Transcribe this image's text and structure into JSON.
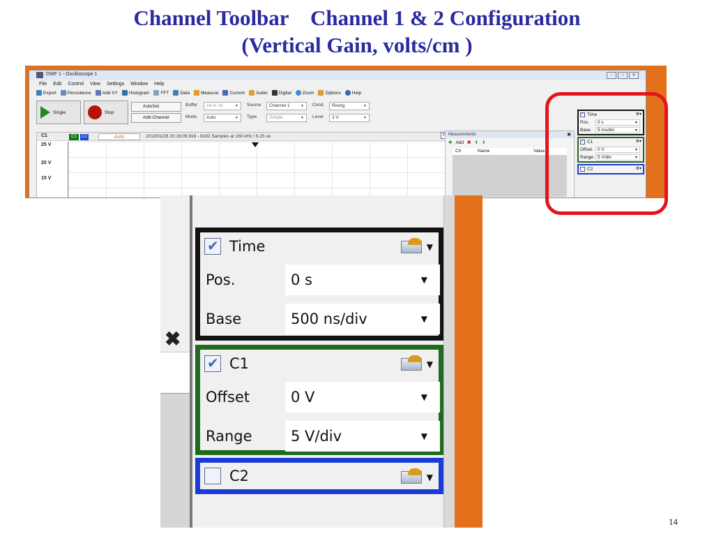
{
  "slide": {
    "title_line1": "Channel Toolbar    Channel 1 & 2 Configuration",
    "title_line2": "(Vertical Gain, volts/cm )",
    "page_number": "14"
  },
  "window": {
    "title": "DWF 1 - Oscilloscope 1",
    "menu": [
      "File",
      "Edit",
      "Control",
      "View",
      "Settings",
      "Window",
      "Help"
    ],
    "toolbar": [
      "Export",
      "Persistence",
      "Add XY",
      "Histogram",
      "FFT",
      "Data",
      "Measure",
      "Current",
      "Audio",
      "Digital",
      "Zoom",
      "Options",
      "Help"
    ]
  },
  "controls": {
    "single_label": "Single",
    "stop_label": "Stop",
    "autoset_label": "AutoSet",
    "add_channel_label": "Add Channel",
    "buffer_label": "Buffer",
    "buffer_value": "16 of 16",
    "mode_label": "Mode",
    "mode_value": "Auto",
    "source_label": "Source",
    "source_value": "Channel 1",
    "type_label": "Type",
    "type_value": "Simple",
    "cond_label": "Cond.",
    "cond_value": "Rising",
    "level_label": "Level",
    "level_value": "3 V"
  },
  "scope": {
    "channel_name": "C1",
    "chip_c1": "C1",
    "chip_c2": "C2",
    "trigger_state": "Auto",
    "status": "2013/01/28 20:16:09.916 - 8192 Samples at 160 kHz / 6.25 us",
    "y_labels": [
      "25 V",
      "20 V",
      "15 V"
    ],
    "y_flag": "Y"
  },
  "measurements": {
    "title": "Measurements",
    "add_label": "Add",
    "columns": [
      "Ch",
      "Name",
      "Value"
    ]
  },
  "mini_panels": {
    "time": {
      "label": "Time",
      "pos_label": "Pos.",
      "pos_value": "0 s",
      "base_label": "Base",
      "base_value": "5 ms/div"
    },
    "c1": {
      "label": "C1",
      "offset_label": "Offset",
      "offset_value": "0 V",
      "range_label": "Range",
      "range_value": "5 V/div"
    },
    "c2": {
      "label": "C2"
    }
  },
  "zoom_panels": {
    "time": {
      "label": "Time",
      "pos_label": "Pos.",
      "pos_value": "0 s",
      "base_label": "Base",
      "base_value": "500 ns/div"
    },
    "c1": {
      "label": "C1",
      "offset_label": "Offset",
      "offset_value": "0 V",
      "range_label": "Range",
      "range_value": "5 V/div"
    },
    "c2": {
      "label": "C2"
    }
  },
  "colors": {
    "title_blue": "#2a2aa0",
    "frame_orange": "#e3711b",
    "highlight_red": "#e3151c",
    "time_panel_border": "#111111",
    "c1_panel_border": "#1e6a1e",
    "c2_panel_border": "#1a3bd6"
  }
}
